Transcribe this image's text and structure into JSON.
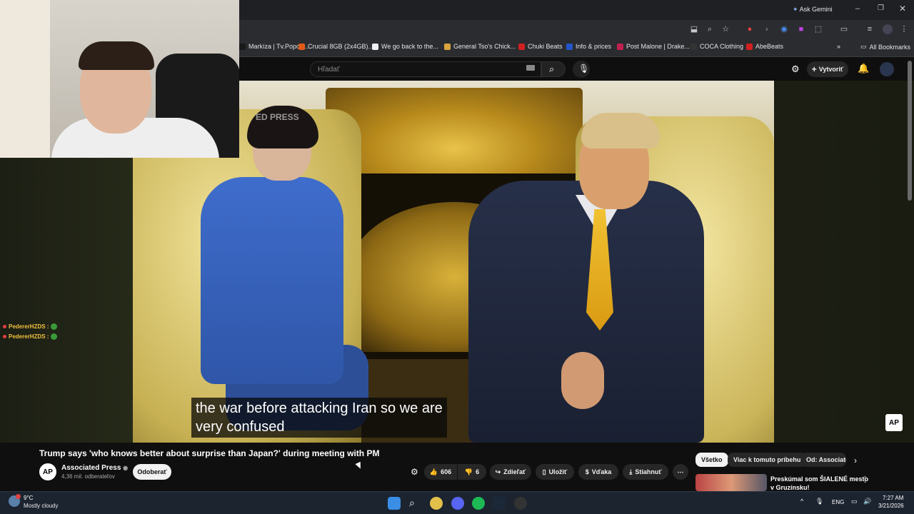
{
  "browser": {
    "ask_gemini": "Ask Gemini",
    "bookmarks": [
      {
        "label": "Markíza | Tv.Popcor...",
        "color": "#1a1a1a"
      },
      {
        "label": "Crucial 8GB (2x4GB)...",
        "color": "#e05a1a"
      },
      {
        "label": "We go back to the...",
        "color": "#f1f1f1"
      },
      {
        "label": "General Tso's Chick...",
        "color": "#d9a540"
      },
      {
        "label": "Chuki Beats",
        "color": "#d02020"
      },
      {
        "label": "Info & prices",
        "color": "#2255cc"
      },
      {
        "label": "Post Malone | Drake...",
        "color": "#c02050"
      },
      {
        "label": "COCA Clothing",
        "color": "#333333"
      },
      {
        "label": "AbeBeats",
        "color": "#d02020"
      }
    ],
    "all_bookmarks": "All Bookmarks"
  },
  "youtube": {
    "search_placeholder": "Hľadať",
    "create_label": "Vytvoriť"
  },
  "video": {
    "subtitle": "the war before attacking Iran so we are\nvery confused",
    "stamp": "ED PRESS",
    "corner_logo": "AP"
  },
  "chat": [
    {
      "user": "PedererHZDS :"
    },
    {
      "user": "PedererHZDS :"
    }
  ],
  "meta": {
    "title": "Trump says 'who knows better about surprise than Japan?' during meeting with PM",
    "channel_initials": "AP",
    "channel_name": "Associated Press",
    "subscribers": "4,36 mil. odberateľov",
    "subscribe_label": "Odoberať",
    "likes": "606",
    "dislikes": "6",
    "share_label": "Zdieľať",
    "save_label": "Uložiť",
    "thanks_label": "Vďaka",
    "download_label": "Stiahnuť"
  },
  "chips": [
    {
      "label": "Všetko",
      "active": true
    },
    {
      "label": "Viac k tomuto príbehu",
      "active": false
    },
    {
      "label": "Od: Associate",
      "active": false
    }
  ],
  "recommendation": {
    "title_line1": "Preskúmal som ŠIALENÉ mesto",
    "title_line2": "v Gruzínsku!"
  },
  "taskbar": {
    "weather_temp": "9°C",
    "weather_desc": "Mostly cloudy",
    "lang": "ENG",
    "time": "7:27 AM",
    "date": "3/21/2026"
  },
  "colors": {
    "accent_red": "#e04040",
    "bg": "#0f0f0f"
  }
}
